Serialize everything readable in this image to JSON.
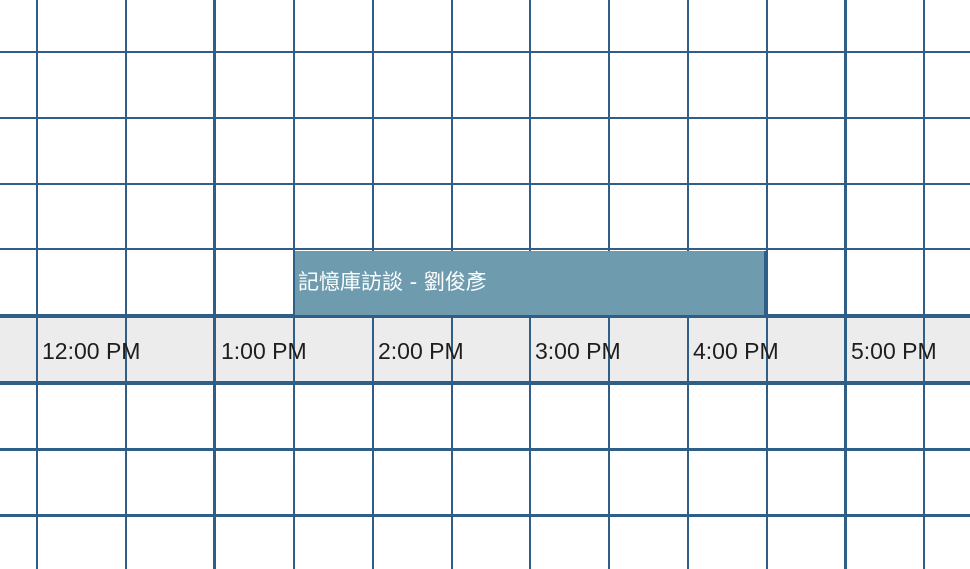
{
  "calendar": {
    "time_labels": [
      "12:00 PM",
      "1:00 PM",
      "2:00 PM",
      "3:00 PM",
      "4:00 PM",
      "5:00 PM"
    ],
    "event": {
      "title": "記憶庫訪談 - 劉俊彥",
      "start": "1:30 PM",
      "end": "4:30 PM",
      "color": "#6e9cae"
    },
    "colors": {
      "gridline": "#2f5f86",
      "time_strip": "#ececec",
      "event_text": "#ffffff"
    }
  }
}
